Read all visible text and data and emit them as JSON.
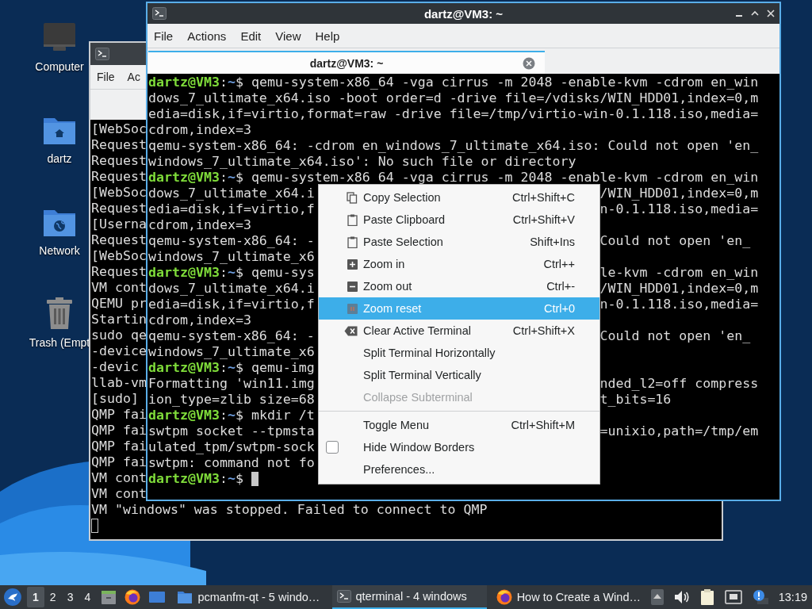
{
  "desktop_icons": [
    {
      "label": "Computer"
    },
    {
      "label": "dartz"
    },
    {
      "label": "Network"
    },
    {
      "label": "Trash (Empt"
    }
  ],
  "windows": [
    {
      "active": false,
      "menu": [
        "File",
        "Ac"
      ],
      "lines": [
        {
          "text": "[WebSoc"
        },
        {
          "text": "Request"
        },
        {
          "text": "Request"
        },
        {
          "text": "Request"
        },
        {
          "text": "[WebSoc"
        },
        {
          "text": "Request"
        },
        {
          "text": "[Userna"
        },
        {
          "text": "Request"
        },
        {
          "text": "[WebSoc"
        },
        {
          "text": "Request"
        },
        {
          "text": "VM cont"
        },
        {
          "text": "QEMU pr"
        },
        {
          "text": "Startin"
        },
        {
          "text": "sudo qe"
        },
        {
          "text": "-device"
        },
        {
          "text": "-devic"
        },
        {
          "text": "llab-vm"
        },
        {
          "text": "[sudo]"
        },
        {
          "text": "QMP fai"
        },
        {
          "text": "QMP fai"
        },
        {
          "text": "QMP fai"
        },
        {
          "text": "QMP fai"
        },
        {
          "text": "VM cont"
        },
        {
          "text": "VM cont"
        },
        {
          "text": "VM \"windows\" was stopped. Failed to connect to QMP"
        },
        {
          "cursor": true
        }
      ]
    },
    {
      "active": true,
      "title": "dartz@VM3: ~",
      "menu": [
        "File",
        "Actions",
        "Edit",
        "View",
        "Help"
      ],
      "tab": "dartz@VM3: ~",
      "lines": [
        {
          "prompt": {
            "user": "dartz@VM3",
            "colon": ":",
            "path": "~",
            "sign": "$"
          },
          "text": "qemu-system-x86_64 -vga cirrus -m 2048 -enable-kvm -cdrom en_win"
        },
        {
          "text": "dows_7_ultimate_x64.iso -boot order=d -drive file=/vdisks/WIN_HDD01,index=0,m"
        },
        {
          "text": "edia=disk,if=virtio,format=raw -drive file=/tmp/virtio-win-0.1.118.iso,media="
        },
        {
          "text": "cdrom,index=3"
        },
        {
          "text": "qemu-system-x86_64: -cdrom en_windows_7_ultimate_x64.iso: Could not open 'en_"
        },
        {
          "text": "windows_7_ultimate_x64.iso': No such file or directory"
        },
        {
          "prompt": {
            "user": "dartz@VM3",
            "colon": ":",
            "path": "~",
            "sign": "$"
          },
          "text": "qemu-system-x86_64 -vga cirrus -m 2048 -enable-kvm -cdrom en_win"
        },
        {
          "text": "dows_7_ultimate_x64.i",
          "tail": "/WIN_HDD01,index=0,m"
        },
        {
          "text": "edia=disk,if=virtio,f",
          "tail": "n-0.1.118.iso,media="
        },
        {
          "text": "cdrom,index=3"
        },
        {
          "text": "qemu-system-x86_64: -",
          "tail": "Could not open 'en_"
        },
        {
          "text": "windows_7_ultimate_x6"
        },
        {
          "prompt": {
            "user": "dartz@VM3",
            "colon": ":",
            "path": "~",
            "sign": "$"
          },
          "text": "qemu-sys",
          "tail": "le-kvm -cdrom en_win"
        },
        {
          "text": "dows_7_ultimate_x64.i",
          "tail": "/WIN_HDD01,index=0,m"
        },
        {
          "text": "edia=disk,if=virtio,f",
          "tail": "n-0.1.118.iso,media="
        },
        {
          "text": "cdrom,index=3"
        },
        {
          "text": "qemu-system-x86_64: -",
          "tail": "Could not open 'en_"
        },
        {
          "text": "windows_7_ultimate_x6"
        },
        {
          "prompt": {
            "user": "dartz@VM3",
            "colon": ":",
            "path": "~",
            "sign": "$"
          },
          "text": "qemu-img"
        },
        {
          "text": "Formatting 'win11.img",
          "tail": "nded_l2=off compress"
        },
        {
          "text": "ion_type=zlib size=68",
          "tail": "t_bits=16"
        },
        {
          "prompt": {
            "user": "dartz@VM3",
            "colon": ":",
            "path": "~",
            "sign": "$"
          },
          "text": "mkdir /t"
        },
        {
          "text": "swtpm socket --tpmsta",
          "tail": "=unixio,path=/tmp/em"
        },
        {
          "text": "ulated_tpm/swtpm-sock"
        },
        {
          "text": "swtpm: command not fo"
        },
        {
          "prompt": {
            "user": "dartz@VM3",
            "colon": ":",
            "path": "~",
            "sign": "$"
          },
          "cursor": true
        }
      ]
    }
  ],
  "context_menu": {
    "items": [
      {
        "kind": "item",
        "label": "Copy Selection",
        "shortcut": "Ctrl+Shift+C",
        "selected": false,
        "disabled": false
      },
      {
        "kind": "item",
        "label": "Paste Clipboard",
        "shortcut": "Ctrl+Shift+V",
        "selected": false,
        "disabled": false
      },
      {
        "kind": "item",
        "label": "Paste Selection",
        "shortcut": "Shift+Ins",
        "selected": false,
        "disabled": false
      },
      {
        "kind": "item",
        "label": "Zoom in",
        "shortcut": "Ctrl++",
        "selected": false,
        "disabled": false
      },
      {
        "kind": "item",
        "label": "Zoom out",
        "shortcut": "Ctrl+-",
        "selected": false,
        "disabled": false
      },
      {
        "kind": "item",
        "label": "Zoom reset",
        "shortcut": "Ctrl+0",
        "selected": true,
        "disabled": false
      },
      {
        "kind": "item",
        "label": "Clear Active Terminal",
        "shortcut": "Ctrl+Shift+X",
        "selected": false,
        "disabled": false
      },
      {
        "kind": "item",
        "label": "Split Terminal Horizontally",
        "selected": false,
        "disabled": false
      },
      {
        "kind": "item",
        "label": "Split Terminal Vertically",
        "selected": false,
        "disabled": false
      },
      {
        "kind": "item",
        "label": "Collapse Subterminal",
        "selected": false,
        "disabled": true
      },
      {
        "kind": "separator"
      },
      {
        "kind": "item",
        "label": "Toggle Menu",
        "shortcut": "Ctrl+Shift+M",
        "selected": false,
        "disabled": false
      },
      {
        "kind": "check",
        "label": "Hide Window Borders",
        "checked": false,
        "selected": false,
        "disabled": false
      },
      {
        "kind": "item",
        "label": "Preferences...",
        "selected": false,
        "disabled": false
      }
    ]
  },
  "taskbar": {
    "workspaces": [
      {
        "label": "1",
        "selected": true
      },
      {
        "label": "2",
        "selected": false
      },
      {
        "label": "3",
        "selected": false
      },
      {
        "label": "4",
        "selected": false
      }
    ],
    "tasks": [
      {
        "label": "pcmanfm-qt - 5 windo…",
        "selected": false
      },
      {
        "label": "qterminal - 4 windows",
        "selected": true
      },
      {
        "label": "How to Create a Wind…",
        "selected": false
      }
    ],
    "clock": "13:19"
  }
}
